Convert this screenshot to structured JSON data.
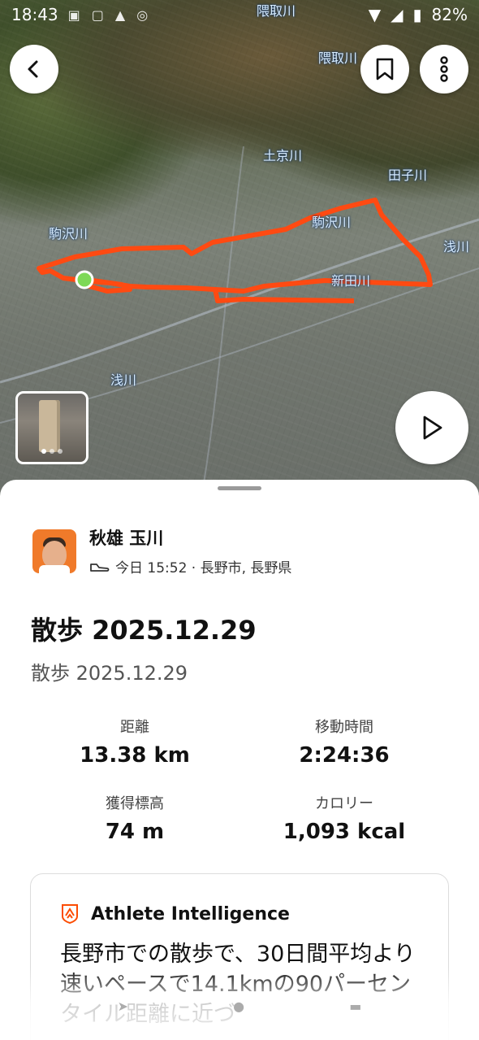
{
  "status_bar": {
    "time": "18:43",
    "battery": "82%"
  },
  "map": {
    "river_labels": [
      "隈取川",
      "隈取川",
      "土京川",
      "田子川",
      "駒沢川",
      "駒沢川",
      "浅川",
      "新田川",
      "浅川"
    ],
    "route_color": "#FF4A12",
    "start_marker_color": "#7ED957"
  },
  "media": {
    "photo_count": 3,
    "active_index": 0
  },
  "athlete": {
    "name": "秋雄 玉川",
    "meta": "今日 15:52 · 長野市, 長野県",
    "avatar_icon": "avatar-photo"
  },
  "activity": {
    "title": "散歩 2025.12.29",
    "subtitle": "散歩 2025.12.29"
  },
  "stats": [
    {
      "label": "距離",
      "value": "13.38 km"
    },
    {
      "label": "移動時間",
      "value": "2:24:36"
    },
    {
      "label": "獲得標高",
      "value": "74 m"
    },
    {
      "label": "カロリー",
      "value": "1,093 kcal"
    }
  ],
  "intelligence": {
    "title": "Athlete Intelligence",
    "icon": "athlete-intelligence-icon",
    "body": "長野市での散歩で、30日間平均より速いペースで14.1kmの90パーセンタイル距離に近づ"
  },
  "colors": {
    "accent": "#FC4C02"
  }
}
